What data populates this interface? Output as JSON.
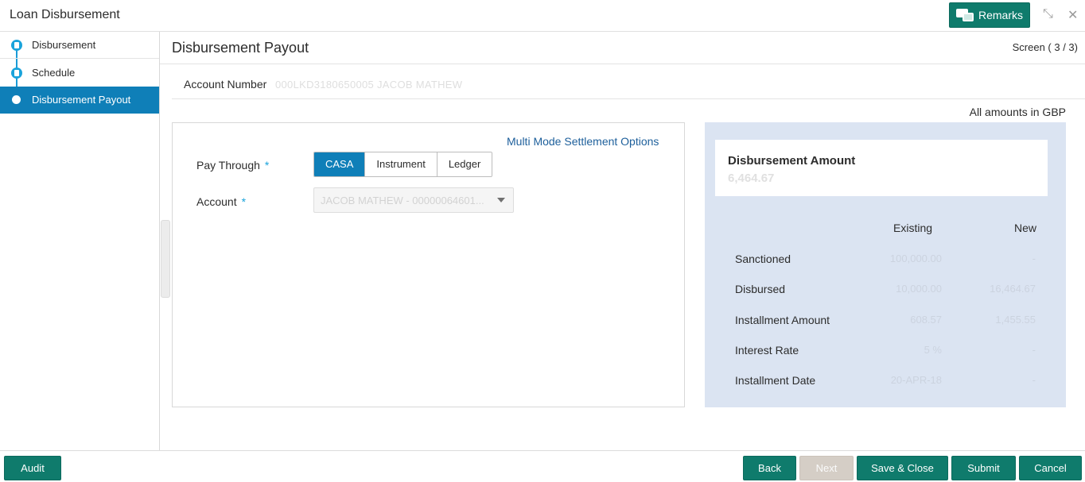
{
  "window": {
    "title": "Loan Disbursement",
    "remarks_label": "Remarks",
    "minimize_glyph": "⤡",
    "close_glyph": "✕"
  },
  "nav": {
    "items": [
      {
        "label": "Disbursement",
        "icon": "step-complete-icon"
      },
      {
        "label": "Schedule",
        "icon": "step-complete-icon"
      },
      {
        "label": "Disbursement Payout",
        "icon": "step-current-icon"
      }
    ]
  },
  "main": {
    "title": "Disbursement Payout",
    "screen_indicator": "Screen ( 3 / 3)",
    "account_label": "Account Number",
    "account_value": "000LKD3180650005  JACOB MATHEW",
    "amounts_note": "All amounts in GBP"
  },
  "settlement": {
    "multi_mode_link": "Multi Mode Settlement Options",
    "pay_through_label": "Pay Through",
    "pay_through_options": [
      "CASA",
      "Instrument",
      "Ledger"
    ],
    "pay_through_selected": "CASA",
    "account_label": "Account",
    "account_value": "JACOB MATHEW - 00000064601...",
    "required_mark": "*"
  },
  "summary": {
    "title": "Disbursement Amount",
    "amount": "6,464.67",
    "col_existing": "Existing",
    "col_new": "New",
    "rows": [
      {
        "label": "Sanctioned",
        "existing": "100,000.00",
        "new": "-"
      },
      {
        "label": "Disbursed",
        "existing": "10,000.00",
        "new": "16,464.67"
      },
      {
        "label": "Installment Amount",
        "existing": "608.57",
        "new": "1,455.55"
      },
      {
        "label": "Interest Rate",
        "existing": "5 %",
        "new": "-"
      },
      {
        "label": "Installment Date",
        "existing": "20-APR-18",
        "new": "-"
      }
    ]
  },
  "footer": {
    "audit": "Audit",
    "back": "Back",
    "next": "Next",
    "save_close": "Save & Close",
    "submit": "Submit",
    "cancel": "Cancel"
  },
  "colors": {
    "primary_button": "#0f7b6c",
    "active_nav": "#0f7fb8",
    "summary_bg": "#dbe4f2",
    "link": "#1d5f9b"
  }
}
